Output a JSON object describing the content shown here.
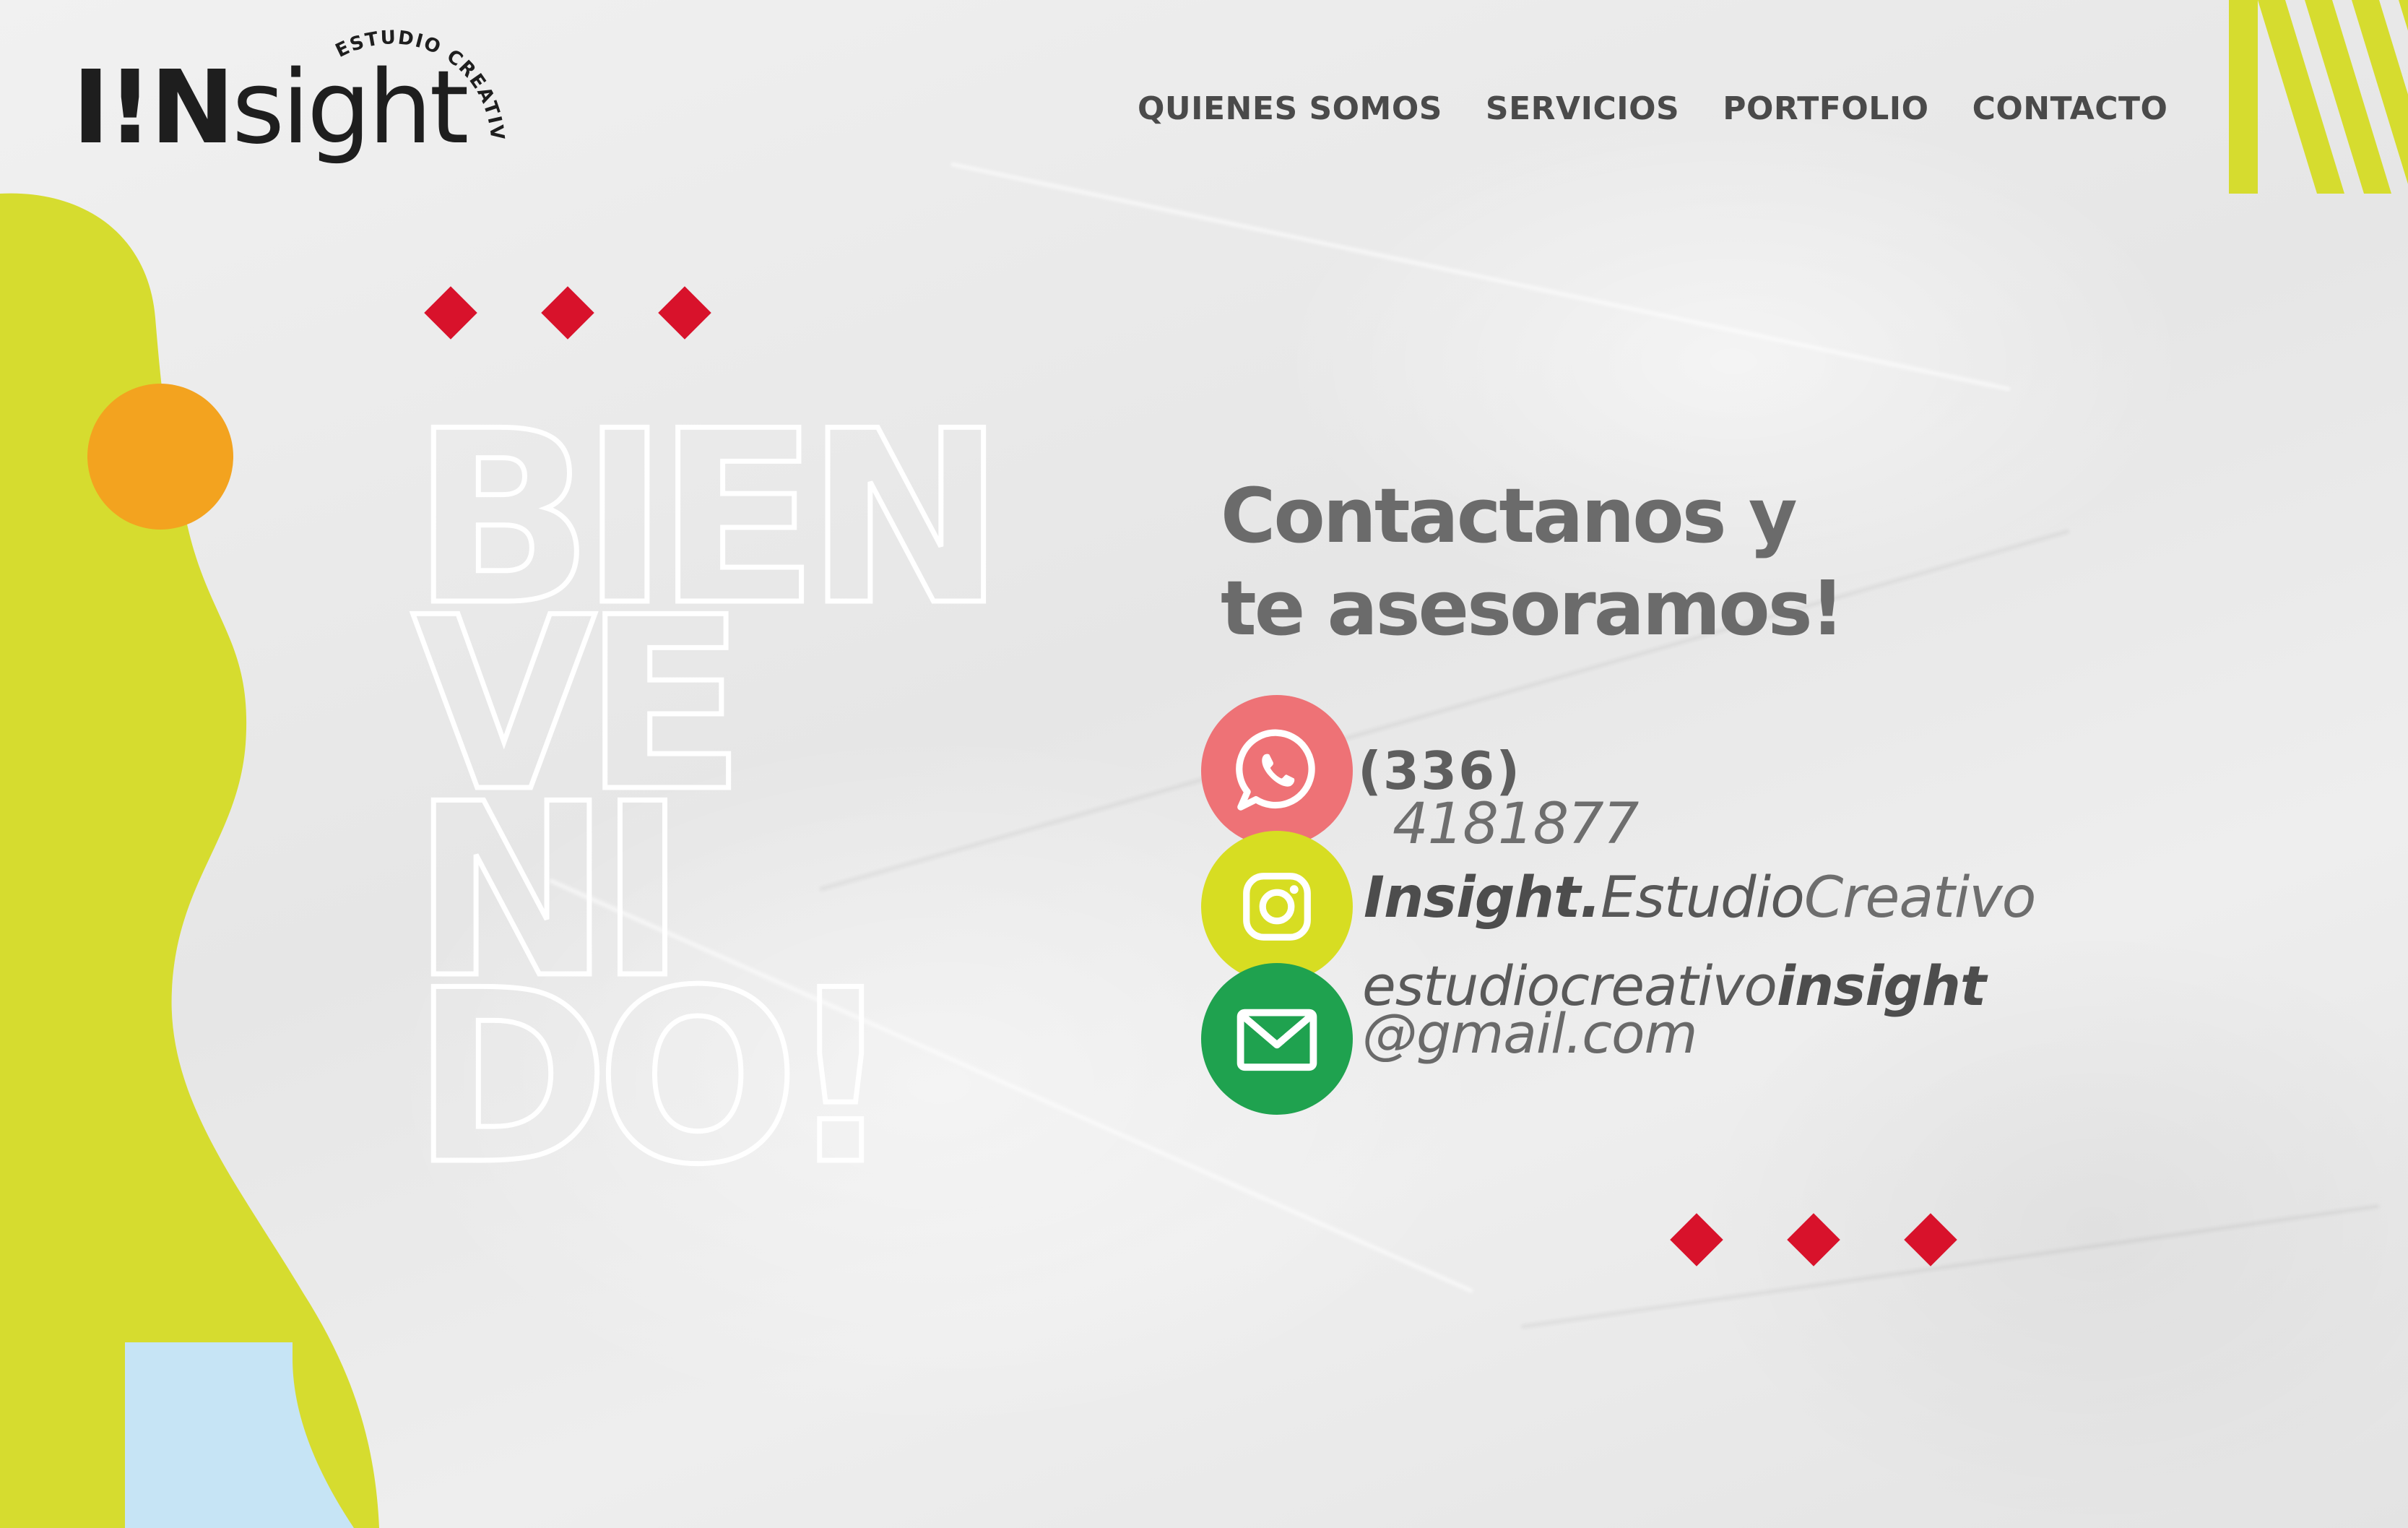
{
  "brand": {
    "logo_prefix": "I",
    "logo_accent": "!N",
    "logo_suffix": "sight",
    "logo_tagline": "ESTUDIO CREATIVO"
  },
  "nav": {
    "items": [
      "QUIENES SOMOS",
      "SERVICIOS",
      "PORTFOLIO",
      "CONTACTO"
    ]
  },
  "hero": {
    "welcome_lines": [
      "BIEN",
      "VE",
      "NI",
      "DO!"
    ],
    "headline_line1": "Contactanos y",
    "headline_line2": "te asesoramos!"
  },
  "contact": {
    "phone_line1": "(336)",
    "phone_line2": "4181877",
    "instagram_bold": "Insight.",
    "instagram_mid": "Estudio",
    "instagram_light": "Creativo",
    "email_light": "estudiocreativo",
    "email_bold": "insight",
    "email_domain": "@gmail.com"
  },
  "icons": {
    "whatsapp": "whatsapp-icon",
    "instagram": "instagram-icon",
    "email": "envelope-icon"
  },
  "colors": {
    "lime": "#d6dc2f",
    "orange": "#f3a31f",
    "light_blue": "#c6e4f5",
    "red": "#d8122b",
    "whatsapp_pink": "#ee7276",
    "instagram_lime": "#d7dd22",
    "email_green": "#1fa24f",
    "text_gray": "#6b6b6b"
  }
}
